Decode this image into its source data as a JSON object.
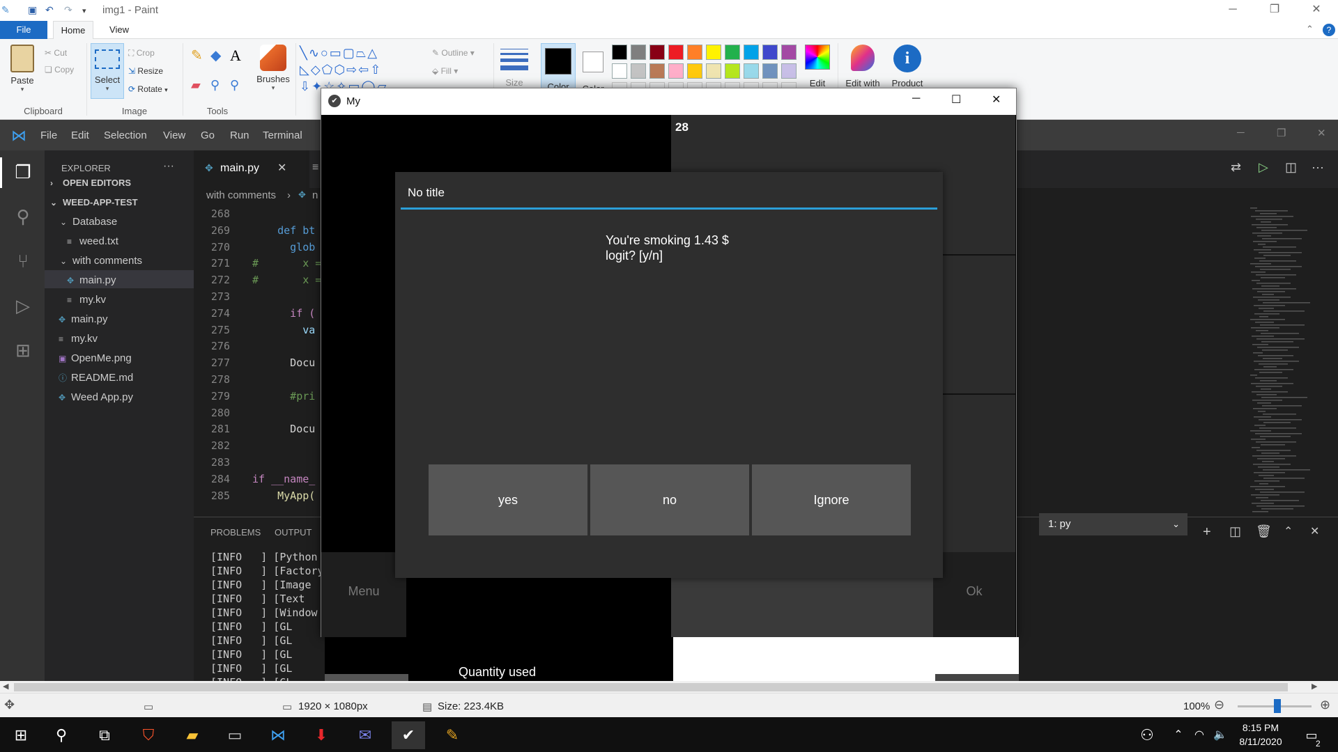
{
  "paint": {
    "title": "img1 - Paint",
    "tabs": {
      "file": "File",
      "home": "Home",
      "view": "View"
    },
    "clipboard": {
      "label": "Clipboard",
      "paste": "Paste",
      "cut": "Cut",
      "copy": "Copy"
    },
    "image": {
      "label": "Image",
      "select": "Select",
      "crop": "Crop",
      "resize": "Resize",
      "rotate": "Rotate"
    },
    "tools": {
      "label": "Tools",
      "brushes": "Brushes",
      "text_glyph": "A"
    },
    "shapes": {
      "outline": "Outline",
      "fill": "Fill"
    },
    "size": "Size",
    "color1": "Color",
    "color2": "Color",
    "edit_colors": "Edit",
    "edit_with": "Edit with",
    "product": "Product",
    "palette_row1": [
      "#000000",
      "#7f7f7f",
      "#880015",
      "#ed1c24",
      "#ff7f27",
      "#fff200",
      "#22b14c",
      "#00a2e8",
      "#3f48cc",
      "#a349a4"
    ],
    "palette_row2": [
      "#ffffff",
      "#c3c3c3",
      "#b97a57",
      "#ffaec9",
      "#ffc90e",
      "#efe4b0",
      "#b5e61d",
      "#99d9ea",
      "#7092be",
      "#c8bfe7"
    ],
    "status": {
      "dimensions": "1920 × 1080px",
      "size": "Size: 223.4KB",
      "zoom": "100%"
    }
  },
  "vscode": {
    "menu": [
      "File",
      "Edit",
      "Selection",
      "View",
      "Go",
      "Run",
      "Terminal"
    ],
    "explorer_title": "EXPLORER",
    "explorer_more": "···",
    "open_editors": "OPEN EDITORS",
    "workspace": "WEED-APP-TEST",
    "tree": {
      "database": "Database",
      "weed_txt": "weed.txt",
      "with_comments": "with comments",
      "main_py_inner": "main.py",
      "my_kv_inner": "my.kv",
      "main_py": "main.py",
      "my_kv": "my.kv",
      "openme": "OpenMe.png",
      "readme": "README.md",
      "weed_app": "Weed App.py"
    },
    "active_tab": "main.py",
    "breadcrumb": "with comments",
    "breadcrumb_tail": "n",
    "lines": [
      {
        "n": "268",
        "code": "",
        "color": "#d4d4d4"
      },
      {
        "n": "269",
        "code": "    def bt",
        "color": "#569cd6"
      },
      {
        "n": "270",
        "code": "      glob",
        "color": "#569cd6"
      },
      {
        "n": "271",
        "code": "#       x =",
        "color": "#6a9955"
      },
      {
        "n": "272",
        "code": "#       x =",
        "color": "#6a9955"
      },
      {
        "n": "273",
        "code": "",
        "color": "#d4d4d4"
      },
      {
        "n": "274",
        "code": "      if (",
        "color": "#c586c0"
      },
      {
        "n": "275",
        "code": "        va",
        "color": "#9cdcfe"
      },
      {
        "n": "276",
        "code": "",
        "color": "#d4d4d4"
      },
      {
        "n": "277",
        "code": "      Docu",
        "color": "#d4d4d4"
      },
      {
        "n": "278",
        "code": "",
        "color": "#d4d4d4"
      },
      {
        "n": "279",
        "code": "      #pri",
        "color": "#6a9955"
      },
      {
        "n": "280",
        "code": "",
        "color": "#d4d4d4"
      },
      {
        "n": "281",
        "code": "      Docu",
        "color": "#d4d4d4"
      },
      {
        "n": "282",
        "code": "",
        "color": "#d4d4d4"
      },
      {
        "n": "283",
        "code": "",
        "color": "#d4d4d4"
      },
      {
        "n": "284",
        "code": "if __name_",
        "color": "#c586c0"
      },
      {
        "n": "285",
        "code": "    MyApp(",
        "color": "#dcdcaa"
      }
    ],
    "panel_tabs": {
      "problems": "PROBLEMS",
      "output": "OUTPUT"
    },
    "logs": [
      "[INFO   ] [Python",
      "[INFO   ] [Factory",
      "[INFO   ] [Image",
      "[INFO   ] [Text",
      "[INFO   ] [Window",
      "[INFO   ] [GL",
      "[INFO   ] [GL",
      "[INFO   ] [GL",
      "[INFO   ] [GL",
      "[INFO   ] [GL"
    ],
    "terminal_select": "1: py"
  },
  "kivy": {
    "title": "My",
    "counter": "28",
    "menu_btn": "Menu",
    "ok_btn": "Ok",
    "quantity_label": "Quantity used",
    "popup": {
      "title": "No title",
      "message_line1": "You're smoking 1.43 $",
      "message_line2": "logit? [y/n]",
      "yes": "yes",
      "no": "no",
      "ignore": "Ignore"
    }
  },
  "taskbar": {
    "time": "8:15 PM",
    "date": "8/11/2020",
    "notification_count": "2"
  }
}
